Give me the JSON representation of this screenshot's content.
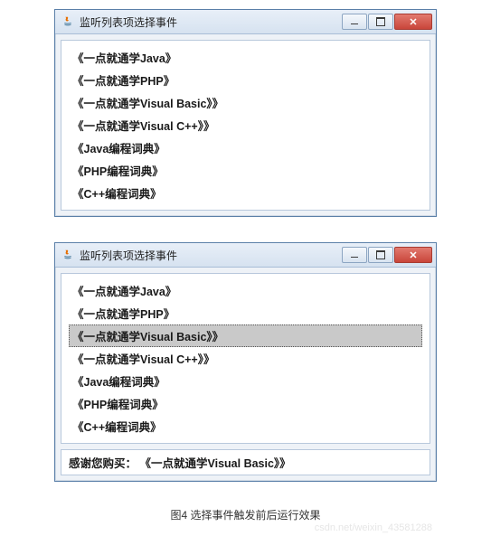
{
  "window_title": "监听列表项选择事件",
  "list_items": [
    "《一点就通学Java》",
    "《一点就通学PHP》",
    "《一点就通学Visual Basic》》",
    "《一点就通学Visual C++》》",
    "《Java编程词典》",
    "《PHP编程词典》",
    "《C++编程词典》"
  ],
  "window2": {
    "selected_index": 2,
    "status_prefix": "感谢您购买：",
    "status_value": "《一点就通学Visual Basic》》"
  },
  "caption": "图4 选择事件触发前后运行效果",
  "watermark": "csdn.net/weixin_43581288"
}
